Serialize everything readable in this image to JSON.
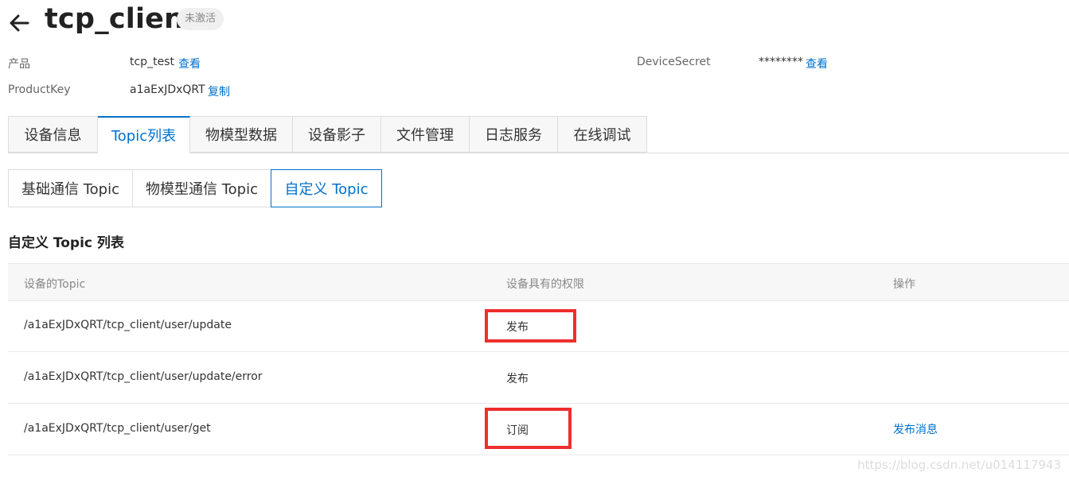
{
  "header": {
    "back_icon": "arrow-left-icon",
    "title": "tcp_client",
    "status_badge": "未激活"
  },
  "info": {
    "product_label": "产品",
    "product_value": "tcp_test",
    "product_view_link": "查看",
    "productkey_label": "ProductKey",
    "productkey_value": "a1aExJDxQRT",
    "productkey_copy_link": "复制",
    "devicesecret_label": "DeviceSecret",
    "devicesecret_value": "********",
    "devicesecret_view_link": "查看"
  },
  "tabs": [
    {
      "label": "设备信息"
    },
    {
      "label": "Topic列表",
      "active": true
    },
    {
      "label": "物模型数据"
    },
    {
      "label": "设备影子"
    },
    {
      "label": "文件管理"
    },
    {
      "label": "日志服务"
    },
    {
      "label": "在线调试"
    }
  ],
  "subtabs": [
    {
      "label": "基础通信 Topic"
    },
    {
      "label": "物模型通信 Topic"
    },
    {
      "label": "自定义 Topic",
      "active": true
    }
  ],
  "section_title": "自定义 Topic 列表",
  "table": {
    "columns": [
      "设备的Topic",
      "设备具有的权限",
      "操作"
    ],
    "rows": [
      {
        "topic": "/a1aExJDxQRT/tcp_client/user/update",
        "permission": "发布",
        "action": ""
      },
      {
        "topic": "/a1aExJDxQRT/tcp_client/user/update/error",
        "permission": "发布",
        "action": ""
      },
      {
        "topic": "/a1aExJDxQRT/tcp_client/user/get",
        "permission": "订阅",
        "action": "发布消息"
      }
    ]
  },
  "colors": {
    "accent": "#0070cc",
    "highlight": "#ee2e2e"
  },
  "watermark": "https://blog.csdn.net/u014117943"
}
